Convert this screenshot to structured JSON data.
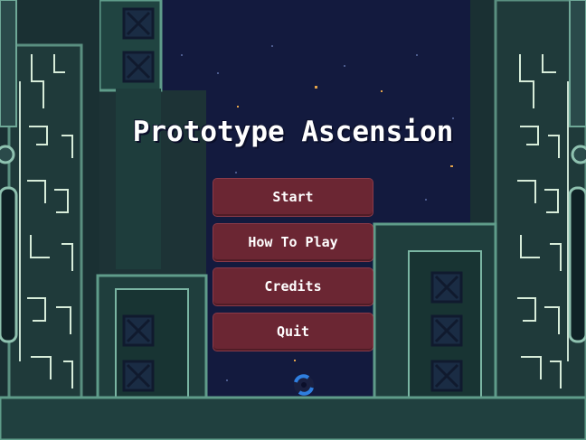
{
  "game": {
    "title": "Prototype Ascension"
  },
  "menu": {
    "buttons": [
      {
        "label": "Start"
      },
      {
        "label": "How To Play"
      },
      {
        "label": "Credits"
      },
      {
        "label": "Quit"
      }
    ]
  },
  "colors": {
    "background": "#1b2f33",
    "sky": "#121a3c",
    "panel_dark": "#0f2226",
    "panel_border": "#5f9c8a",
    "panel_fill": "#20403f",
    "circuit": "#cfe8d8",
    "button_fill": "#6b2633",
    "button_border": "#8a3a48",
    "title_text": "#ffffff",
    "spark": "#c98b2e"
  },
  "icons": {
    "loading": "spinner-icon",
    "crate": "x-crate-icon"
  }
}
